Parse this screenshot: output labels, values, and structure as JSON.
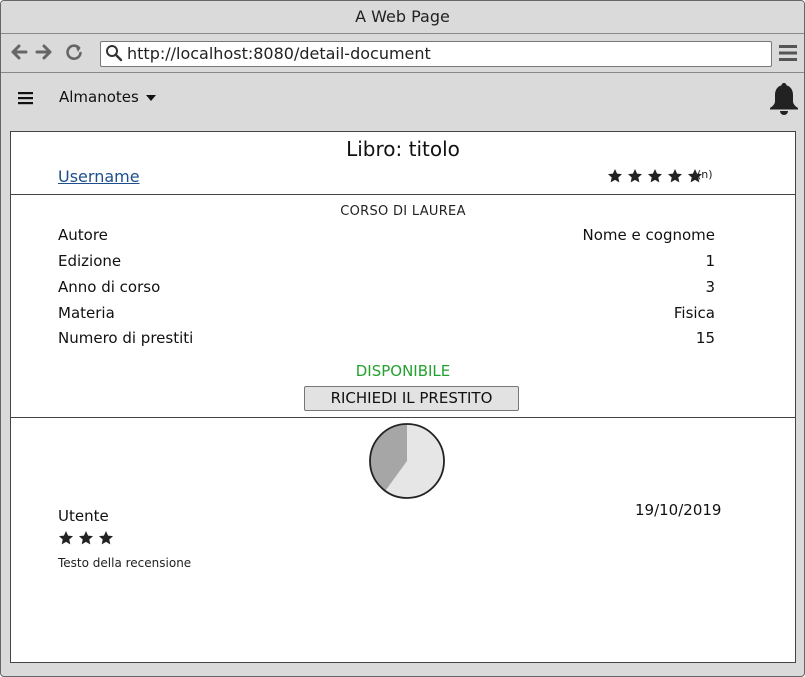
{
  "window": {
    "title": "A Web Page"
  },
  "browser": {
    "url": "http://localhost:8080/detail-document",
    "back_icon": "arrow-left-icon",
    "forward_icon": "arrow-right-icon",
    "reload_icon": "reload-icon",
    "search_icon": "search-icon",
    "menu_icon": "hamburger-menu-icon"
  },
  "appbar": {
    "menu_icon": "hamburger-menu-icon",
    "brand": "Almanotes",
    "caret_icon": "caret-down-icon",
    "bell_icon": "bell-icon"
  },
  "book": {
    "title": "Libro: titolo",
    "username": "Username",
    "rating_stars": 5,
    "rating_count": "(n)"
  },
  "course": "CORSO DI LAUREA",
  "details": [
    {
      "label": "Autore",
      "value": "Nome e cognome"
    },
    {
      "label": "Edizione",
      "value": "1"
    },
    {
      "label": "Anno di corso",
      "value": "3"
    },
    {
      "label": "Materia",
      "value": "Fisica"
    },
    {
      "label": "Numero di prestiti",
      "value": "15"
    }
  ],
  "status": {
    "text": "DISPONIBILE",
    "color": "#23a12f"
  },
  "request_button": "RICHIEDI IL PRESTITO",
  "availability_pie": {
    "filled_fraction": 0.4,
    "filled_color": "#a6a6a6",
    "empty_color": "#e6e6e6"
  },
  "review": {
    "user": "Utente",
    "date": "19/10/2019",
    "stars": 3,
    "text": "Testo della recensione"
  }
}
